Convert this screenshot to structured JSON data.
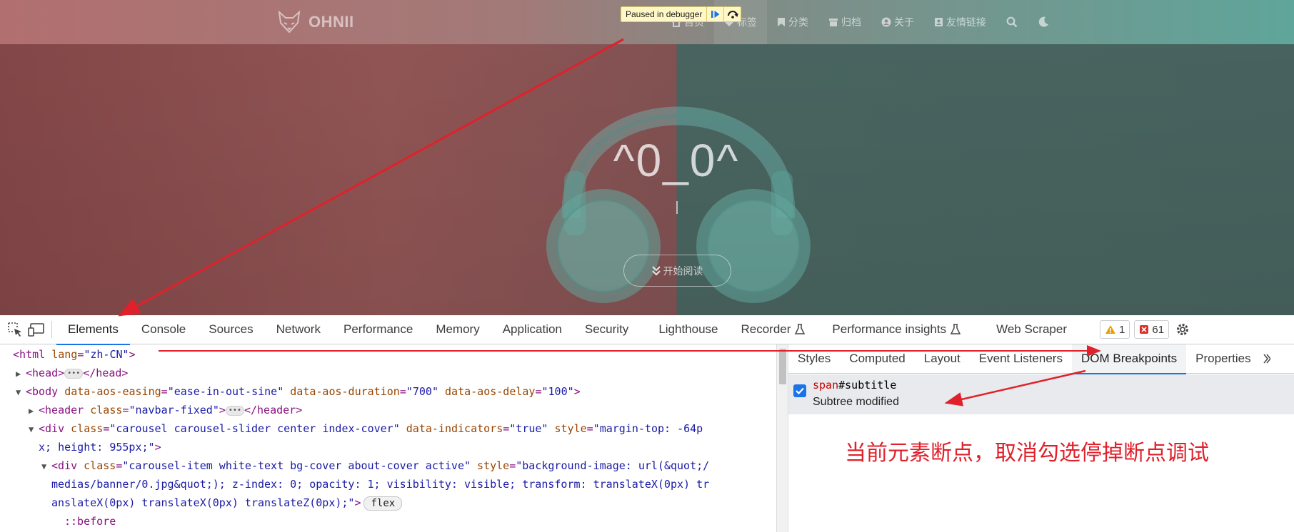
{
  "page": {
    "logo": "OHNII",
    "nav": [
      {
        "label": "首页",
        "icon": "home-icon"
      },
      {
        "label": "标签",
        "icon": "tags-icon"
      },
      {
        "label": "分类",
        "icon": "bookmark-icon"
      },
      {
        "label": "归档",
        "icon": "archive-icon"
      },
      {
        "label": "关于",
        "icon": "user-circle-icon"
      },
      {
        "label": "友情链接",
        "icon": "address-book-icon"
      }
    ],
    "hero_title": "^0_0^",
    "read_button": "开始阅读",
    "debug_banner": "Paused in debugger"
  },
  "devtools": {
    "tabs": [
      "Elements",
      "Console",
      "Sources",
      "Network",
      "Performance",
      "Memory",
      "Application",
      "Security",
      "Lighthouse",
      "Recorder",
      "Performance insights",
      "Web Scraper"
    ],
    "active_tab": "Elements",
    "warnings": "1",
    "errors": "61",
    "dom": {
      "html_tag": "<html ",
      "html_attr": "lang",
      "html_val": "\"zh-CN\"",
      "head_open": "<head>",
      "head_close": "</head>",
      "body_open": "<body ",
      "body_a1": "data-aos-easing",
      "body_v1": "\"ease-in-out-sine\"",
      "body_a2": "data-aos-duration",
      "body_v2": "\"700\"",
      "body_a3": "data-aos-delay",
      "body_v3": "\"100\"",
      "header_open": "<header ",
      "header_attr": "class",
      "header_val": "\"navbar-fixed\"",
      "header_close": "</header>",
      "div1_open": "<div ",
      "div1_a1": "class",
      "div1_v1": "\"carousel carousel-slider center index-cover\"",
      "div1_a2": "data-indicators",
      "div1_v2": "\"true\"",
      "div1_a3": "style",
      "div1_v3a": "\"margin-top: -64p",
      "div1_v3b": "x; height: 955px;\"",
      "div2_open": "<div ",
      "div2_a1": "class",
      "div2_v1": "\"carousel-item white-text bg-cover about-cover active\"",
      "div2_a2": "style",
      "div2_v2a": "\"background-image: url(&quot;/",
      "div2_v2b": "medias/banner/0.jpg&quot;); z-index: 0; opacity: 1; visibility: visible; transform: translateX(0px) tr",
      "div2_v2c": "anslateX(0px) translateX(0px) translateZ(0px);\"",
      "flex": "flex",
      "pseudo": "::before"
    },
    "side_tabs": [
      "Styles",
      "Computed",
      "Layout",
      "Event Listeners",
      "DOM Breakpoints",
      "Properties"
    ],
    "side_active": "DOM Breakpoints",
    "breakpoint": {
      "tag": "span",
      "selector": "#subtitle",
      "type": "Subtree modified",
      "checked": true
    }
  },
  "annotation": "当前元素断点，取消勾选停掉断点调试",
  "colors": {
    "annotation": "#e0212b",
    "accent": "#1a73e8"
  }
}
